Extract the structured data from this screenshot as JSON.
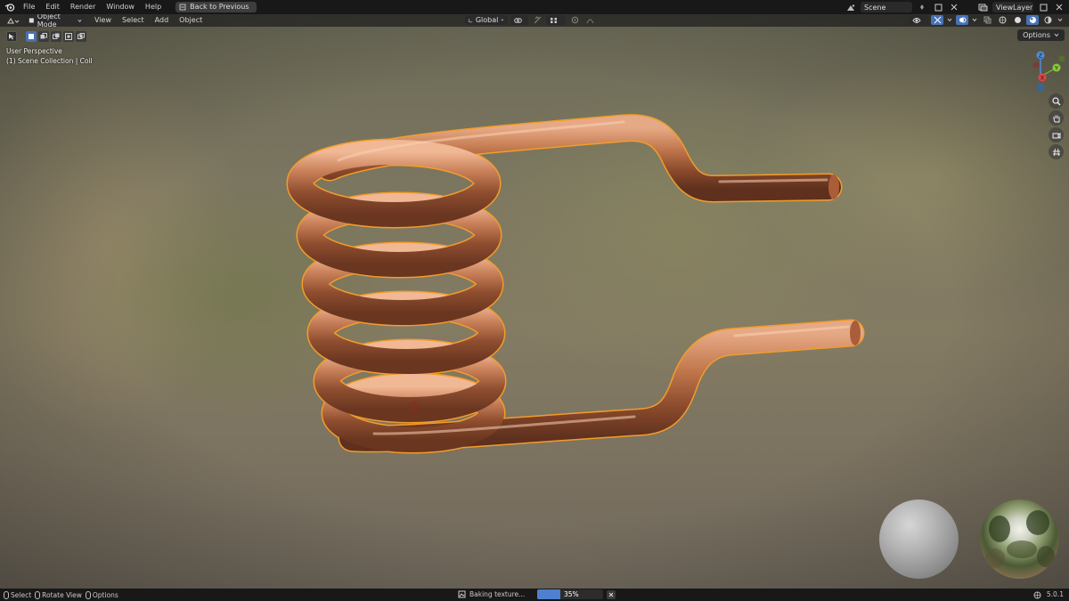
{
  "menu": {
    "items": [
      "File",
      "Edit",
      "Render",
      "Window",
      "Help"
    ],
    "back_label": "Back to Previous"
  },
  "topright": {
    "scene": "Scene",
    "view_layer": "ViewLayer"
  },
  "header": {
    "mode": "Object Mode",
    "menus": [
      "View",
      "Select",
      "Add",
      "Object"
    ],
    "orientation": "Global",
    "options_label": "Options"
  },
  "overlay": {
    "view_name": "User Perspective",
    "collection": "(1) Scene Collection | Coil"
  },
  "gizmo": {
    "x": "X",
    "y": "Y",
    "z": "Z"
  },
  "statusbar": {
    "select": "Select",
    "rotate": "Rotate View",
    "options": "Options",
    "bake_text": "Baking texture...",
    "progress_label": "35%",
    "progress_fraction": 0.35,
    "version": "5.0.1"
  },
  "colors": {
    "accent": "#4772b3",
    "copper": "#b8693f",
    "selection_outline": "#f39c2a"
  },
  "icons": [
    "blender-logo-icon",
    "back-icon",
    "scene-icon",
    "view-layer-icon",
    "editor-type-icon",
    "object-mode-icon",
    "select-box-icon",
    "orientation-icon",
    "pivot-icon",
    "snap-icon",
    "proportional-icon",
    "visibility-icon",
    "gizmo-icon",
    "overlay-icon",
    "xray-icon",
    "wireframe-shading-icon",
    "solid-shading-icon",
    "material-shading-icon",
    "rendered-shading-icon",
    "zoom-icon",
    "hand-pan-icon",
    "camera-view-icon",
    "grid-ortho-icon",
    "cursor-icon",
    "close-icon",
    "mouse-icon"
  ]
}
